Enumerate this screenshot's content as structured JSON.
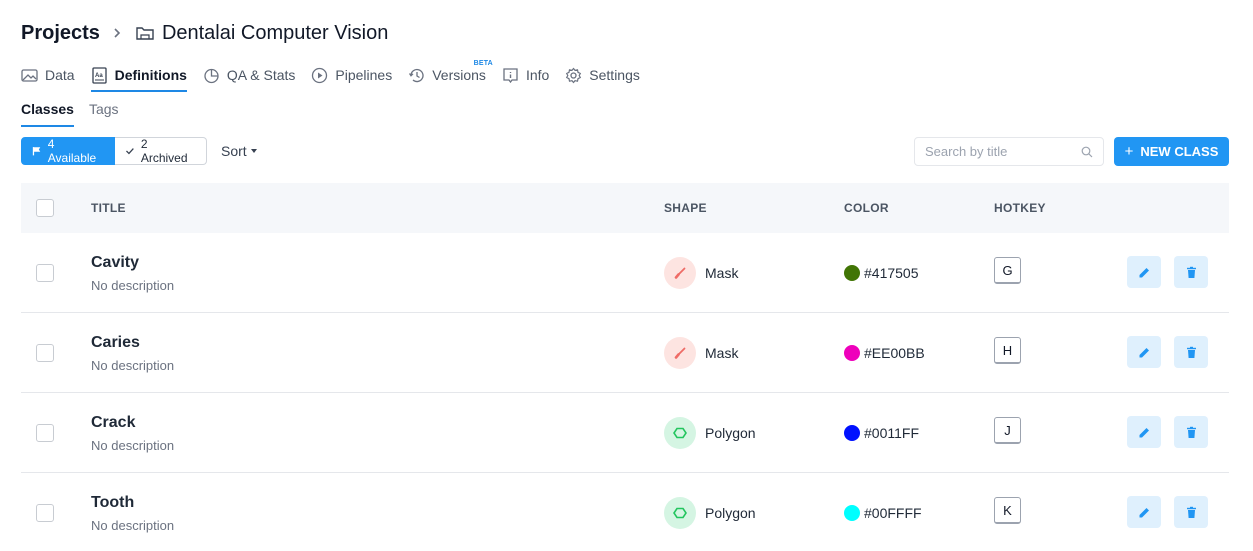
{
  "breadcrumb": {
    "root": "Projects",
    "project_name": "Dentalai Computer Vision"
  },
  "nav": {
    "items": [
      {
        "label": "Data",
        "icon": "image-icon"
      },
      {
        "label": "Definitions",
        "icon": "definitions-icon",
        "active": true
      },
      {
        "label": "QA & Stats",
        "icon": "pie-chart-icon"
      },
      {
        "label": "Pipelines",
        "icon": "play-circle-icon"
      },
      {
        "label": "Versions",
        "icon": "history-icon",
        "badge": "BETA"
      },
      {
        "label": "Info",
        "icon": "info-icon"
      },
      {
        "label": "Settings",
        "icon": "gear-icon"
      }
    ]
  },
  "subnav": {
    "classes": "Classes",
    "tags": "Tags"
  },
  "filters": {
    "available": "4 Available",
    "archived": "2 Archived",
    "sort": "Sort"
  },
  "search": {
    "placeholder": "Search by title"
  },
  "new_button": {
    "plus": "+",
    "label": "NEW CLASS"
  },
  "table": {
    "headers": {
      "title": "TITLE",
      "shape": "SHAPE",
      "color": "COLOR",
      "hotkey": "HOTKEY"
    },
    "rows": [
      {
        "title": "Cavity",
        "description": "No description",
        "shape": "Mask",
        "color": "#417505",
        "hotkey": "G"
      },
      {
        "title": "Caries",
        "description": "No description",
        "shape": "Mask",
        "color": "#EE00BB",
        "hotkey": "H"
      },
      {
        "title": "Crack",
        "description": "No description",
        "shape": "Polygon",
        "color": "#0011FF",
        "hotkey": "J"
      },
      {
        "title": "Tooth",
        "description": "No description",
        "shape": "Polygon",
        "color": "#00FFFF",
        "hotkey": "K"
      }
    ]
  },
  "colors": {
    "accent": "#2196f3",
    "mask_icon_bg": "#fde4e1",
    "mask_icon_fg": "#ef6b66",
    "polygon_icon_bg": "#d5f5e3",
    "polygon_icon_fg": "#22c55e",
    "action_bg": "#dff0fd"
  }
}
